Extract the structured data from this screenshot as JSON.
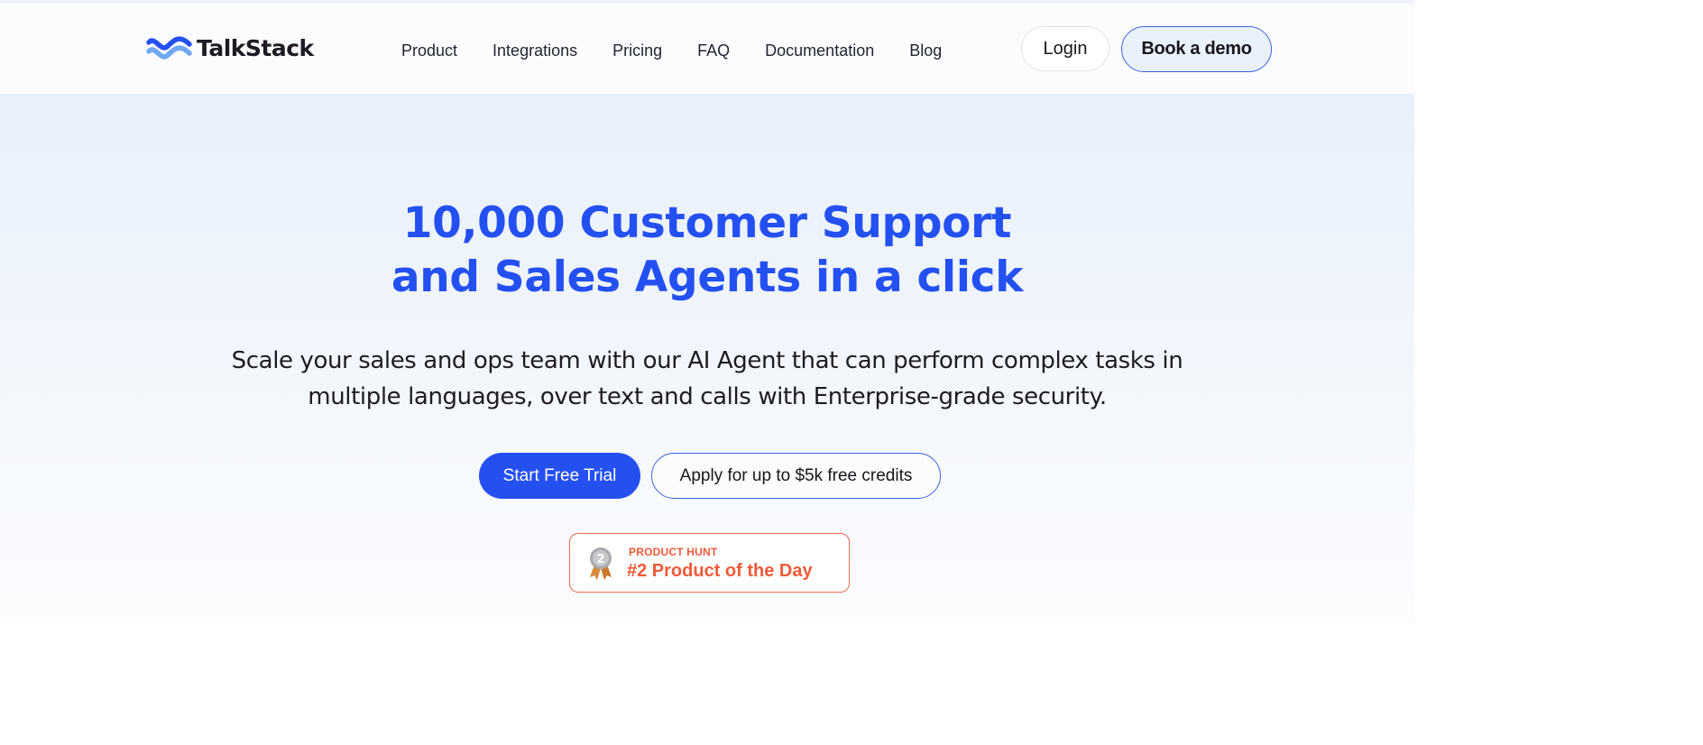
{
  "brand": {
    "name": "TalkStack",
    "icon": "wave-logo-icon"
  },
  "nav": {
    "items": [
      "Product",
      "Integrations",
      "Pricing",
      "FAQ",
      "Documentation",
      "Blog"
    ]
  },
  "header_actions": {
    "login_label": "Login",
    "demo_label": "Book a demo"
  },
  "hero": {
    "headline_line1": "10,000 Customer Support",
    "headline_line2": "and Sales Agents in a click",
    "subline_line1": "Scale your sales and ops team with our AI Agent that can perform complex tasks in",
    "subline_line2": "multiple languages, over text and calls with Enterprise-grade security.",
    "primary_cta": "Start Free Trial",
    "secondary_cta": "Apply for up to $5k free credits"
  },
  "product_hunt": {
    "kicker": "PRODUCT HUNT",
    "title": "#2 Product of the Day",
    "medal_number": "2",
    "icon": "silver-medal-icon"
  },
  "colors": {
    "accent": "#2450f2",
    "product_hunt": "#ef5a3a"
  }
}
